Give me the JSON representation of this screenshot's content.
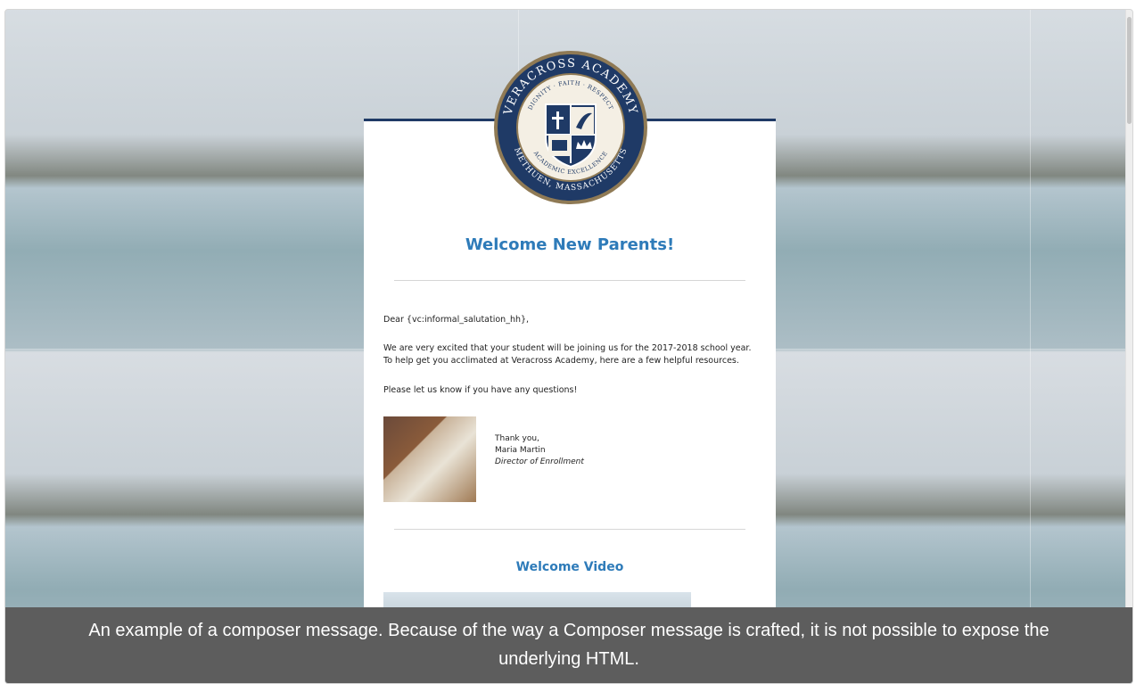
{
  "email": {
    "crest": {
      "ring_top_text": "VERACROSS ACADEMY",
      "ring_bottom_text": "METHUEN, MASSACHUSETTS",
      "inner_text": "DIGNITY · FAITH · RESPECT",
      "motto": "ACADEMIC EXCELLENCE"
    },
    "title": "Welcome New Parents!",
    "greeting": "Dear {vc:informal_salutation_hh},",
    "body_1": "We are very excited that your student will be joining us for the 2017-2018 school year. To help get you acclimated at Veracross Academy, here are a few helpful resources.",
    "body_2": "Please let us know if you have any questions!",
    "signature": {
      "closing": "Thank you,",
      "name": "Maria Martin",
      "role": "Director of Enrollment"
    },
    "video_title": "Welcome Video"
  },
  "caption": "An example of a composer message. Because of the way a Composer message is crafted, it is not possible to expose the underlying HTML.",
  "colors": {
    "accent": "#2e7bb9",
    "navy": "#1f3a66",
    "caption_bg": "#5d5d5d"
  }
}
